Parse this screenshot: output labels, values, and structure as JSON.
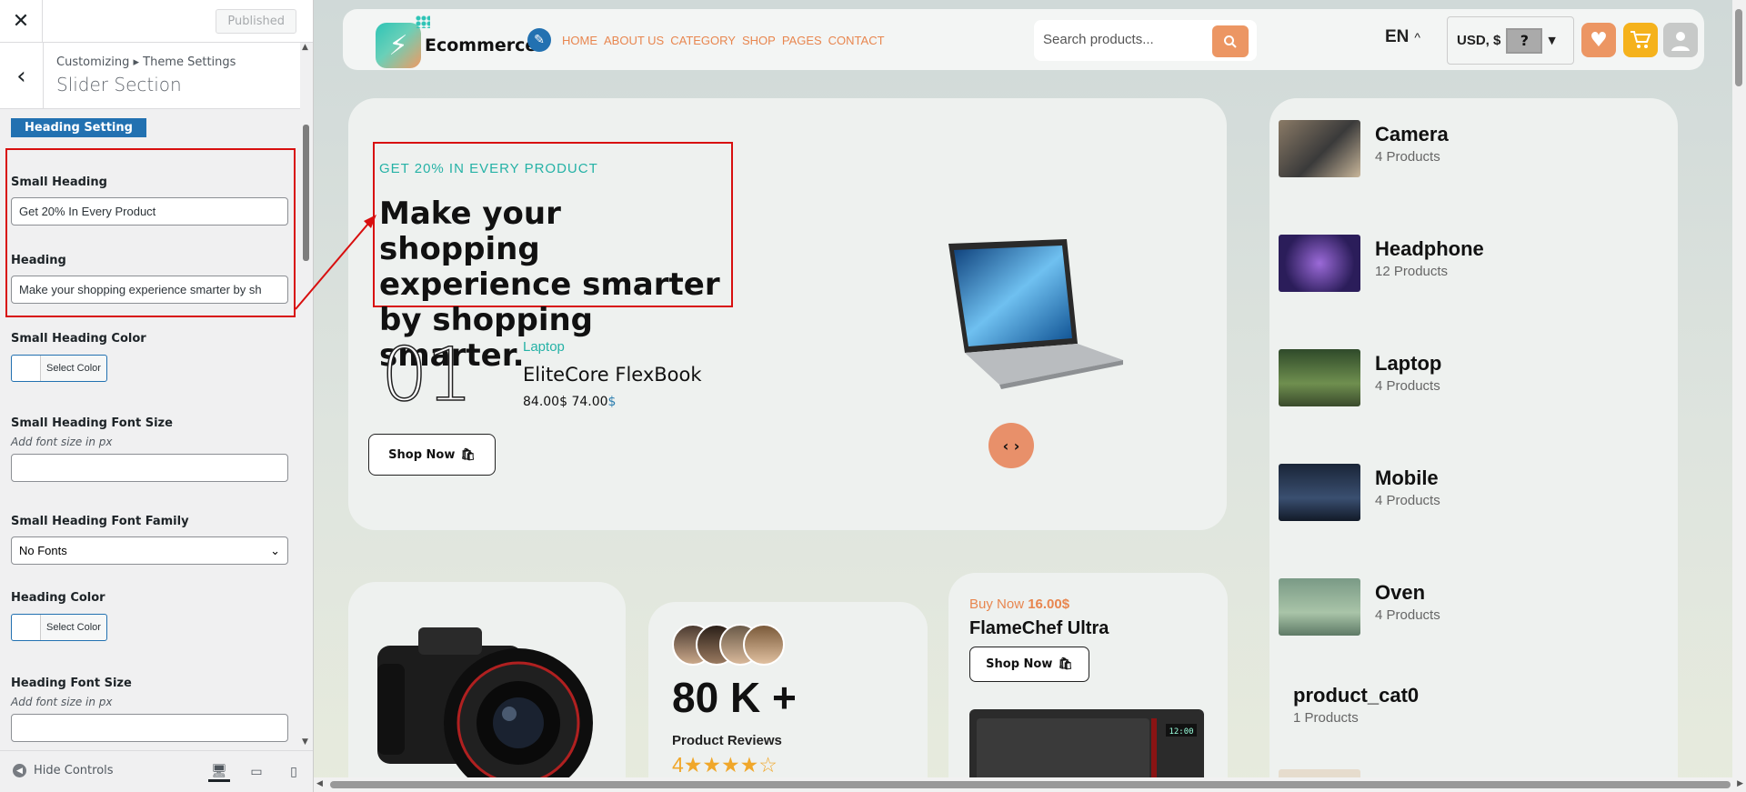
{
  "customizer": {
    "published_label": "Published",
    "breadcrumb": "Customizing ▸ Theme Settings",
    "section_title": "Slider Section",
    "heading_setting_badge": "Heading Setting",
    "small_heading_label": "Small Heading",
    "small_heading_value": "Get 20% In Every Product",
    "heading_label": "Heading",
    "heading_value": "Make your shopping experience smarter by sh",
    "small_heading_color_label": "Small Heading Color",
    "select_color_label": "Select Color",
    "small_heading_font_size_label": "Small Heading Font Size",
    "add_font_size_hint": "Add font size in px",
    "small_heading_font_family_label": "Small Heading Font Family",
    "font_family_value": "No Fonts",
    "heading_color_label": "Heading Color",
    "heading_font_size_label": "Heading Font Size",
    "hide_controls_label": "Hide Controls"
  },
  "header": {
    "logo_text": "Ecommerce",
    "nav": [
      "HOME",
      "ABOUT US",
      "CATEGORY",
      "SHOP",
      "PAGES",
      "CONTACT"
    ],
    "search_placeholder": "Search products...",
    "language": "EN",
    "currency": "USD, $",
    "flag_glyph": "?"
  },
  "hero": {
    "small_heading": "GET 20% IN EVERY PRODUCT",
    "heading": "Make your shopping experience smarter by shopping smarter.",
    "slide_number": "01",
    "product_category": "Laptop",
    "product_name": "EliteCore FlexBook",
    "old_price": "84.00$",
    "new_price": "74.00",
    "currency_symbol": "$",
    "shop_now": "Shop Now"
  },
  "categories": [
    {
      "name": "Camera",
      "count": "4 Products"
    },
    {
      "name": "Headphone",
      "count": "12 Products"
    },
    {
      "name": "Laptop",
      "count": "4 Products"
    },
    {
      "name": "Mobile",
      "count": "4 Products"
    },
    {
      "name": "Oven",
      "count": "4 Products"
    },
    {
      "name": "product_cat0",
      "count": "1 Products"
    }
  ],
  "reviews": {
    "count": "80 K +",
    "label": "Product Reviews",
    "rating": "4",
    "stars": "★★★★☆"
  },
  "promo": {
    "buy_now_prefix": "Buy Now",
    "price": "16.00$",
    "product_name": "FlameChef Ultra",
    "shop_now": "Shop Now",
    "display_time": "12:00"
  },
  "colors": {
    "accent_orange": "#e8864f",
    "accent_teal": "#25b2a6",
    "wp_blue": "#2271b1",
    "highlight_red": "#d80f0f"
  }
}
